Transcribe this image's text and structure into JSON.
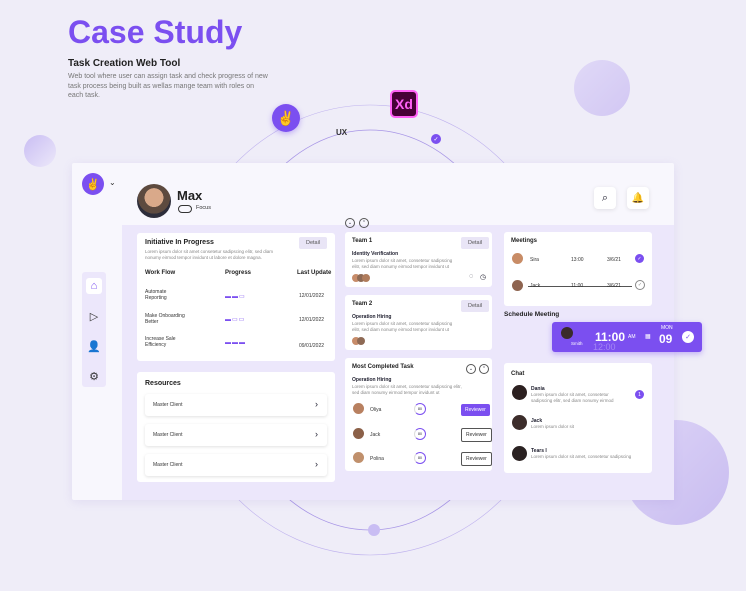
{
  "hero": {
    "title": "Case Study",
    "subtitle": "Task Creation Web Tool",
    "description": "Web tool where user can assign task and check progress of new task process being built as wellas mange team with roles on each task."
  },
  "tools": {
    "xd": "Xd",
    "ux": "UX"
  },
  "header": {
    "user_name": "Max",
    "focus_label": "Focus"
  },
  "initiative": {
    "title": "Initiative In Progress",
    "detail": "Detail",
    "desc": "Lorem ipsum dolor sit amet consetetur sadipscing elitr, sed diam nonumy eirmod tempor invidunt ut labore et dolore magna.",
    "col_workflow": "Work Flow",
    "col_progress": "Progress",
    "col_update": "Last Update",
    "rows": [
      {
        "name": "Automate Reporting",
        "date": "12/01/2022"
      },
      {
        "name": "Make Onboarding Better",
        "date": "12/01/2022"
      },
      {
        "name": "Increase Sale Efficiency",
        "date": "09/01/2022"
      }
    ]
  },
  "resources": {
    "title": "Resources",
    "items": [
      "Master Client",
      "Master Client",
      "Master Client"
    ]
  },
  "teams": [
    {
      "title": "Team 1",
      "detail": "Detail",
      "sub": "Identity Verification",
      "desc": "Lorem ipsum dolor sit amet, consetetur sadipscing elitr, sed diam nonumy eirmod tempor invidunt ut labore et"
    },
    {
      "title": "Team 2",
      "detail": "Detail",
      "sub": "Operation Hiring",
      "desc": "Lorem ipsum dolor sit amet, consetetur sadipscing elitr, sed diam nonumy eirmod tempor invidunt ut labore et"
    }
  ],
  "completed": {
    "title": "Most Completed Task",
    "sub": "Operation Hiring",
    "desc": "Lorem ipsum dolor sit amet, consetetur sadipscing elitr, sed diam nonumy eirmod tempor invidunt ut",
    "people": [
      {
        "name": "Oliya",
        "pct": "80",
        "role": "Reviewer"
      },
      {
        "name": "Jack",
        "pct": "80",
        "role": "Reviewer"
      },
      {
        "name": "Polina",
        "pct": "80",
        "role": "Reviewer"
      }
    ]
  },
  "meetings": {
    "title": "Meetings",
    "rows": [
      {
        "name": "Sira",
        "time": "13:00",
        "date": "3/6/21"
      },
      {
        "name": "Jack",
        "time": "11:00",
        "date": "3/6/21"
      }
    ]
  },
  "schedule": {
    "title": "Schedule Meeting",
    "name": "Smith",
    "time": "11:00",
    "ampm": "AM",
    "next_time": "12:00",
    "day_label": "MON",
    "day": "09"
  },
  "chat": {
    "title": "Chat",
    "items": [
      {
        "name": "Dania",
        "msg": "Lorem ipsum dolor sit amet, consetetur sadipscing elitr, sed diam nonumy eirmod",
        "badge": "1"
      },
      {
        "name": "Jack",
        "msg": "Lorem ipsum dolor sit"
      },
      {
        "name": "Tears I",
        "msg": "Lorem ipsum dolor sit amet, consetetur sadipscing"
      }
    ]
  },
  "colors": {
    "accent": "#7b4ff0",
    "bg": "#efedf8"
  }
}
